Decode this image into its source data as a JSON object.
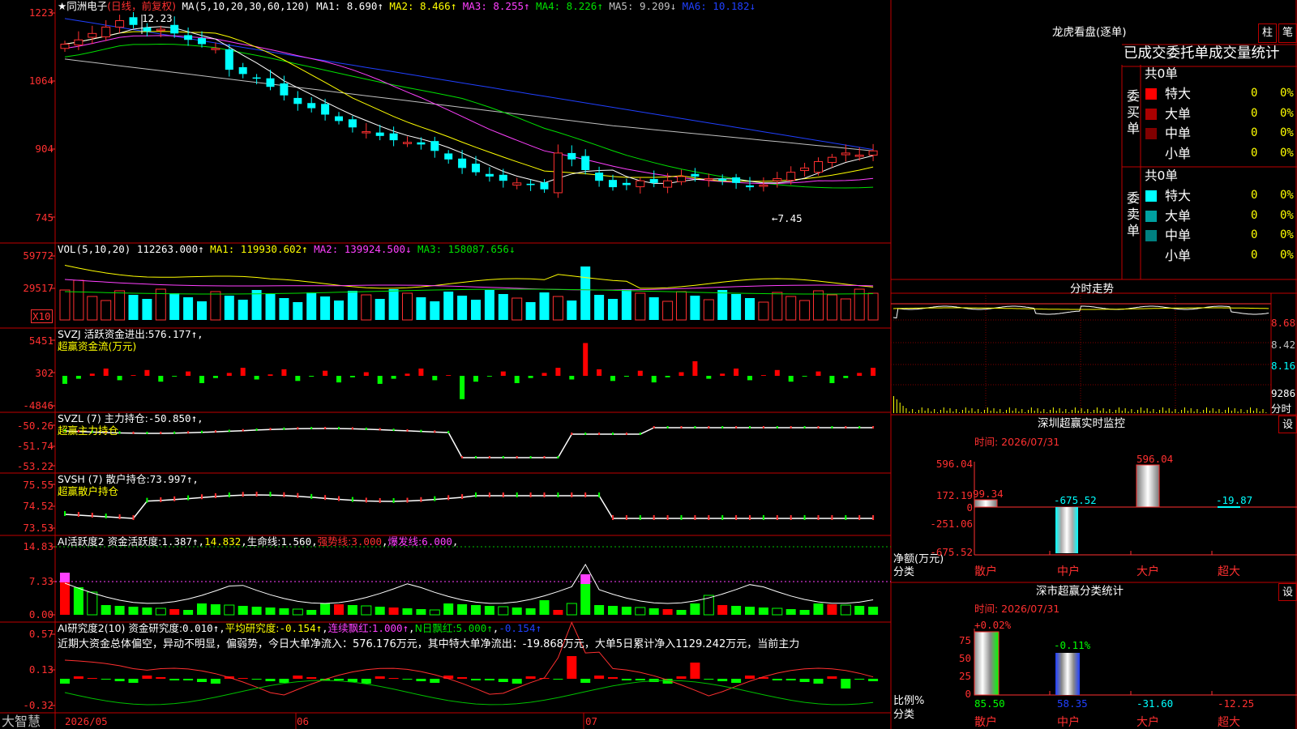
{
  "stock": {
    "name": "同洲电子",
    "mode": "(日线，前复权)",
    "high_mark": "12.23",
    "low_mark": "←7.45"
  },
  "main": {
    "axis": [
      "1223",
      "1064",
      "904",
      "745"
    ],
    "ma_title": "MA(5,10,20,30,60,120)",
    "ma": [
      {
        "label": "MA1:",
        "value": "8.690↑",
        "color": "#ffffff"
      },
      {
        "label": "MA2:",
        "value": "8.466↑",
        "color": "#ffff00"
      },
      {
        "label": "MA3:",
        "value": "8.255↑",
        "color": "#ff40ff"
      },
      {
        "label": "MA4:",
        "value": "8.226↑",
        "color": "#00e000"
      },
      {
        "label": "MA5:",
        "value": "9.209↓",
        "color": "#c0c0c0"
      },
      {
        "label": "MA6:",
        "value": "10.182↓",
        "color": "#2040ff"
      }
    ]
  },
  "vol": {
    "axis": [
      "59772",
      "29517"
    ],
    "unit": "X10",
    "title": "VOL(5,10,20)",
    "value": "112263.000↑",
    "ma": [
      {
        "label": "MA1:",
        "value": "119930.602↑",
        "color": "#ffff00"
      },
      {
        "label": "MA2:",
        "value": "139924.500↓",
        "color": "#ff40ff"
      },
      {
        "label": "MA3:",
        "value": "158087.656↓",
        "color": "#00e000"
      }
    ]
  },
  "svzj": {
    "axis": [
      "5451",
      "302",
      "-4846"
    ],
    "title": "SVZJ  活跃资金进出:",
    "value": "576.177↑,",
    "sub": "超赢资金流(万元)"
  },
  "svzl": {
    "axis": [
      "-50.26",
      "-51.74",
      "-53.22"
    ],
    "title": "SVZL (7) 主力持仓:",
    "value": "-50.850↑,",
    "sub": "超赢主力持仓"
  },
  "svsh": {
    "axis": [
      "75.55",
      "74.52",
      "73.53"
    ],
    "title": "SVSH (7) 散户持仓:",
    "value": "73.997↑,",
    "sub": "超赢散户持仓"
  },
  "ai1": {
    "axis": [
      "14.83",
      "7.33",
      "0.00"
    ],
    "title": "AI活跃度2 资金活跃度:",
    "v1": "1.387↑",
    "v2": "14.832",
    "v3": "生命线:",
    "v4": "1.560",
    "v5": "强势线:",
    "v6": "3.000",
    "v7": "爆发线:",
    "v8": "6.000"
  },
  "ai2": {
    "axis": [
      "0.57",
      "0.13",
      "-0.32"
    ],
    "title": "AI研究度2(10) 资金研究度:",
    "v1": "0.010↑",
    "v2": "平均研究度:",
    "v3": "-0.154↑",
    "v4": "连续飘红:",
    "v5": "1.000↑",
    "v6": "N日飘红:",
    "v7": "5.000↑",
    "v8": "-0.154↑",
    "comment": "近期大资金总体偏空，异动不明显，偏弱势，今日大单净流入：576.176万元，其中特大单净流出：-19.868万元，大单5日累计净入1129.242万元，当前主力"
  },
  "bottom": {
    "logo": "大智慧",
    "dates": [
      "2026/05",
      "06",
      "07"
    ]
  },
  "lhb": {
    "title": "龙虎看盘(逐单)",
    "btn1": "柱",
    "btn2": "笔",
    "header": "已成交委托单成交量统计",
    "buy": {
      "label": "委买单",
      "count": "共0单",
      "rows": [
        {
          "name": "特大",
          "v": "0",
          "p": "0%",
          "color": "#ff0000"
        },
        {
          "name": "大单",
          "v": "0",
          "p": "0%",
          "color": "#aa0000"
        },
        {
          "name": "中单",
          "v": "0",
          "p": "0%",
          "color": "#800000"
        },
        {
          "name": "小单",
          "v": "0",
          "p": "0%",
          "color": "#000000"
        }
      ]
    },
    "sell": {
      "label": "委卖单",
      "count": "共0单",
      "rows": [
        {
          "name": "特大",
          "v": "0",
          "p": "0%",
          "color": "#00ffff"
        },
        {
          "name": "大单",
          "v": "0",
          "p": "0%",
          "color": "#00a0a0"
        },
        {
          "name": "中单",
          "v": "0",
          "p": "0%",
          "color": "#008080"
        },
        {
          "name": "小单",
          "v": "0",
          "p": "0%",
          "color": "#000000"
        }
      ]
    }
  },
  "fenshi": {
    "title": "分时走势",
    "axis": [
      "8.68",
      "8.42",
      "8.16",
      "9286",
      "分时"
    ]
  },
  "sz": {
    "title": "深圳超赢实时监控",
    "btn": "设",
    "time": "时间: 2026/07/31",
    "axis": [
      "596.04",
      "172.19",
      "0",
      "-251.06",
      "-675.52"
    ],
    "ylabel": "净额(万元)",
    "xlabel": "分类",
    "cats": [
      "散户",
      "中户",
      "大户",
      "超大"
    ],
    "values": [
      "99.34",
      "-675.52",
      "596.04",
      "-19.87"
    ]
  },
  "sm": {
    "title": "深市超赢分类统计",
    "btn": "设",
    "time": "时间: 2026/07/31",
    "axis": [
      "75",
      "50",
      "25",
      "0"
    ],
    "ylabel": "比例%",
    "xlabel": "分类",
    "cats": [
      "散户",
      "中户",
      "大户",
      "超大"
    ],
    "top": [
      "+0.02%",
      "-0.11%"
    ],
    "bottom": [
      "85.50",
      "58.35",
      "-31.60",
      "-12.25"
    ]
  }
}
